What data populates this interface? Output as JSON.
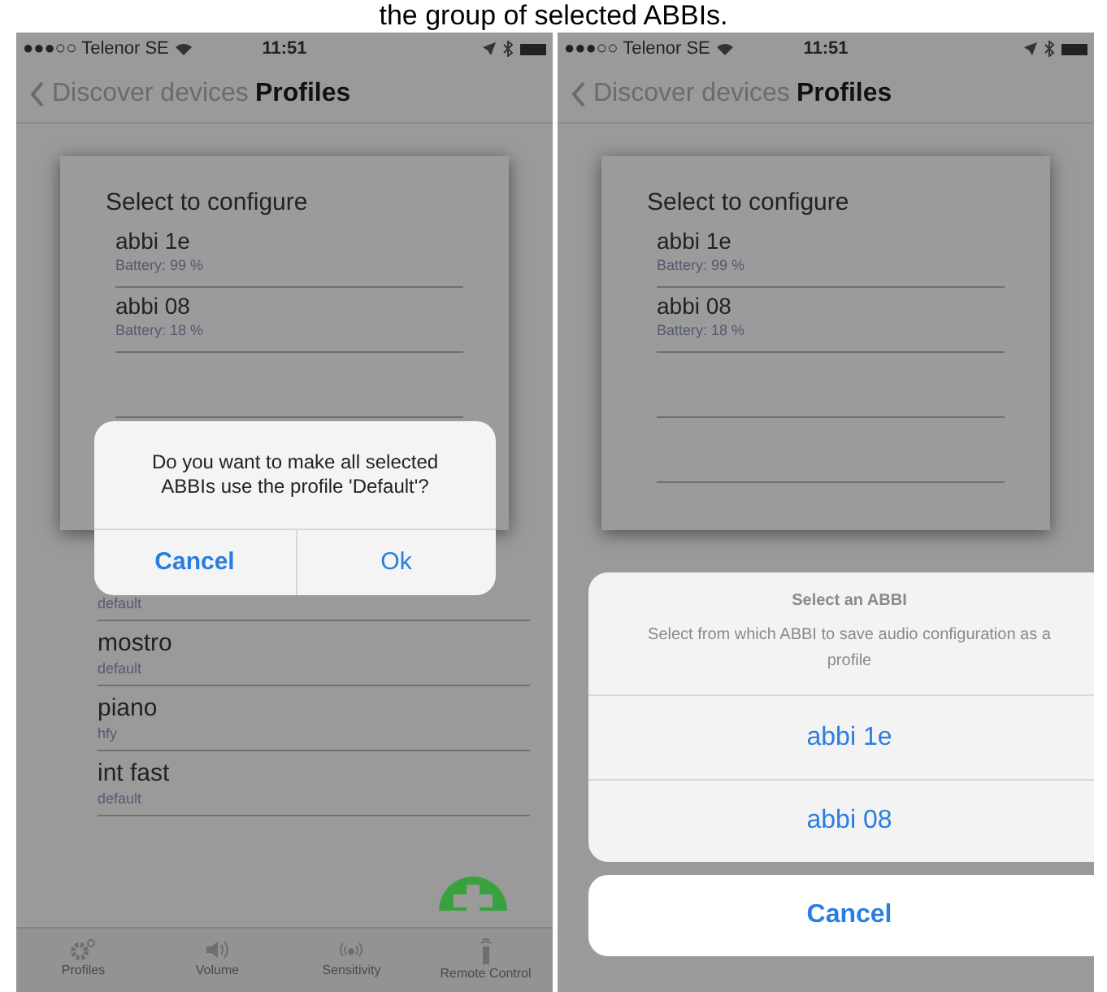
{
  "caption": "the group of selected ABBIs.",
  "phones": [
    {
      "status_bar": {
        "carrier": "●●●○○ Telenor SE",
        "time": "11:51"
      },
      "nav": {
        "back": "Discover devices",
        "title": "Profiles"
      },
      "card": {
        "title": "Select to configure",
        "devices": [
          {
            "name": "abbi 1e",
            "battery": "Battery: 99 %"
          },
          {
            "name": "abbi 08",
            "battery": "Battery: 18 %"
          }
        ]
      },
      "profiles": [
        {
          "sub": "default"
        },
        {
          "name": "mostro",
          "sub": "default"
        },
        {
          "name": "piano",
          "sub": "hfy"
        },
        {
          "name": "int fast",
          "sub": "default"
        }
      ],
      "tabs": [
        "Profiles",
        "Volume",
        "Sensitivity",
        "Remote Control"
      ],
      "dialog": {
        "kind": "alert",
        "message": "Do you want to make all selected ABBIs use the profile 'Default'?",
        "buttons": [
          {
            "label": "Cancel",
            "bold": true
          },
          {
            "label": "Ok",
            "bold": false
          }
        ]
      }
    },
    {
      "status_bar": {
        "carrier": "●●●○○ Telenor SE",
        "time": "11:51"
      },
      "nav": {
        "back": "Discover devices",
        "title": "Profiles"
      },
      "card": {
        "title": "Select to configure",
        "devices": [
          {
            "name": "abbi 1e",
            "battery": "Battery: 99 %"
          },
          {
            "name": "abbi 08",
            "battery": "Battery: 18 %"
          }
        ]
      },
      "dialog": {
        "kind": "action_sheet",
        "title": "Select an ABBI",
        "message": "Select from which ABBI to save audio configuration as a profile",
        "options": [
          "abbi 1e",
          "abbi 08"
        ],
        "cancel": "Cancel"
      }
    }
  ]
}
